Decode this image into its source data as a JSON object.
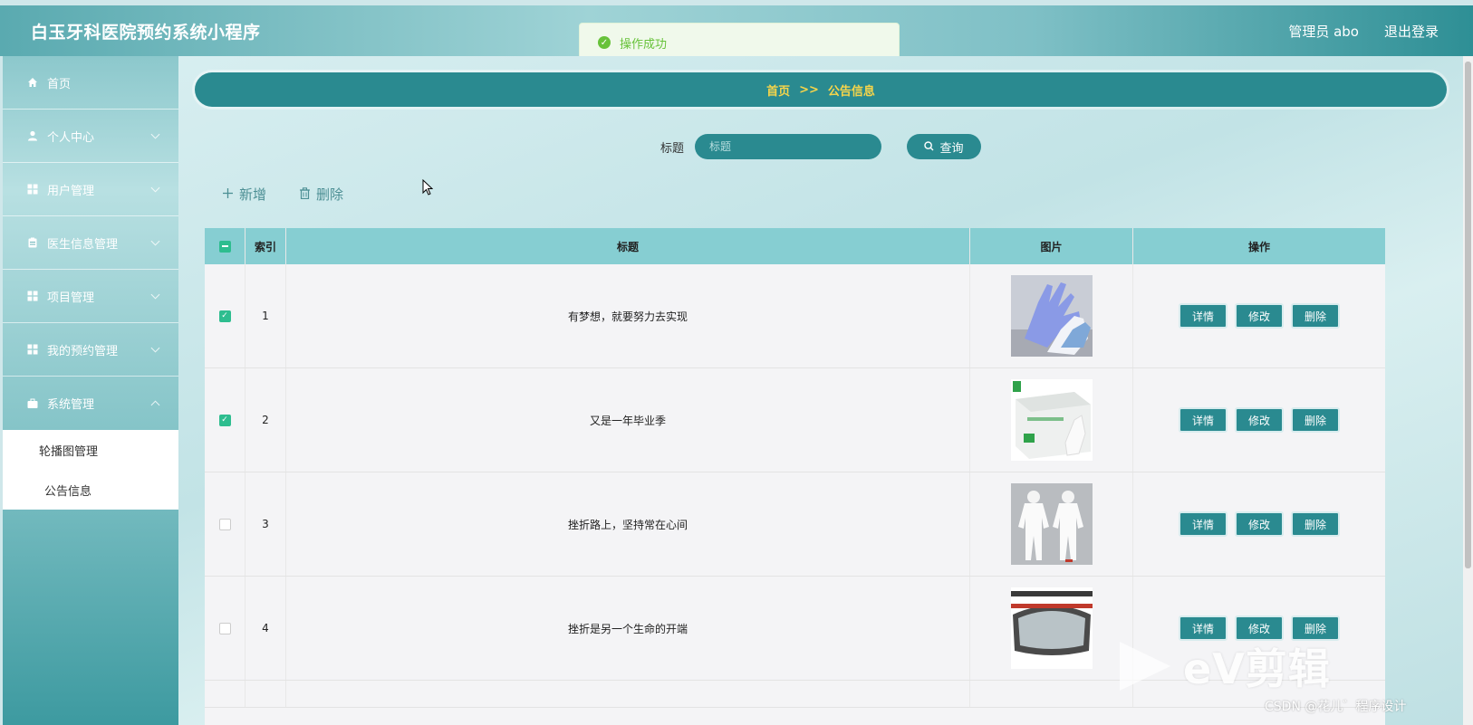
{
  "header": {
    "app_title": "白玉牙科医院预约系统小程序",
    "admin_label": "管理员 abo",
    "logout_label": "退出登录"
  },
  "toast": {
    "message": "操作成功"
  },
  "sidebar": {
    "items": [
      {
        "label": "首页",
        "icon": "home-icon"
      },
      {
        "label": "个人中心",
        "icon": "user-icon"
      },
      {
        "label": "用户管理",
        "icon": "grid-icon"
      },
      {
        "label": "医生信息管理",
        "icon": "clipboard-icon"
      },
      {
        "label": "项目管理",
        "icon": "grid-icon"
      },
      {
        "label": "我的预约管理",
        "icon": "grid-icon"
      },
      {
        "label": "系统管理",
        "icon": "briefcase-icon"
      }
    ],
    "submenu": [
      {
        "label": "轮播图管理"
      },
      {
        "label": "公告信息"
      }
    ]
  },
  "breadcrumb": {
    "home": "首页",
    "separator": ">>",
    "current": "公告信息"
  },
  "search": {
    "label": "标题",
    "placeholder": "标题",
    "button_label": "查询"
  },
  "actions": {
    "add_label": "新增",
    "delete_label": "删除"
  },
  "table": {
    "headers": {
      "index": "索引",
      "title": "标题",
      "image": "图片",
      "ops": "操作"
    },
    "rows": [
      {
        "index": "1",
        "title": "有梦想，就要努力去实现",
        "checked": true,
        "image": "gloves"
      },
      {
        "index": "2",
        "title": "又是一年毕业季",
        "checked": true,
        "image": "glove-box"
      },
      {
        "index": "3",
        "title": "挫折路上，坚持常在心间",
        "checked": false,
        "image": "protective-suit"
      },
      {
        "index": "4",
        "title": "挫折是另一个生命的开端",
        "checked": false,
        "image": "goggles"
      }
    ],
    "op_labels": {
      "detail": "详情",
      "edit": "修改",
      "delete": "删除"
    }
  },
  "watermark": {
    "brand": "eV剪辑",
    "credit": "CSDN @花儿゛程序设计"
  },
  "colors": {
    "primary": "#2a8a90",
    "header_th": "#86ced2",
    "success": "#67c23a",
    "breadcrumb_text": "#f7d54a"
  }
}
